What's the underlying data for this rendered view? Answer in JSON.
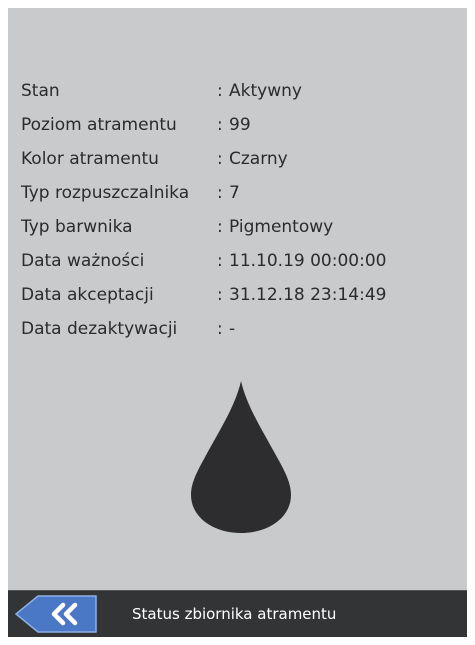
{
  "fields": [
    {
      "label": "Stan",
      "separator": ":",
      "value": "Aktywny"
    },
    {
      "label": "Poziom atramentu",
      "separator": ":",
      "value": "99"
    },
    {
      "label": "Kolor atramentu",
      "separator": ":",
      "value": "Czarny"
    },
    {
      "label": "Typ rozpuszczalnika",
      "separator": ":",
      "value": "7"
    },
    {
      "label": "Typ barwnika",
      "separator": ":",
      "value": "Pigmentowy"
    },
    {
      "label": "Data ważności",
      "separator": ":",
      "value": "11.10.19 00:00:00"
    },
    {
      "label": "Data akceptacji",
      "separator": ":",
      "value": "31.12.18 23:14:49"
    },
    {
      "label": "Data dezaktywacji",
      "separator": ":",
      "value": "-"
    }
  ],
  "ink_drop": {
    "icon": "ink-drop-icon",
    "color": "#2d2d2f"
  },
  "bottom_bar": {
    "back_icon": "double-chevron-left-icon",
    "title": "Status zbiornika atramentu"
  },
  "colors": {
    "background": "#c9cacc",
    "bar": "#333436",
    "back_button": "#4a78c6"
  }
}
